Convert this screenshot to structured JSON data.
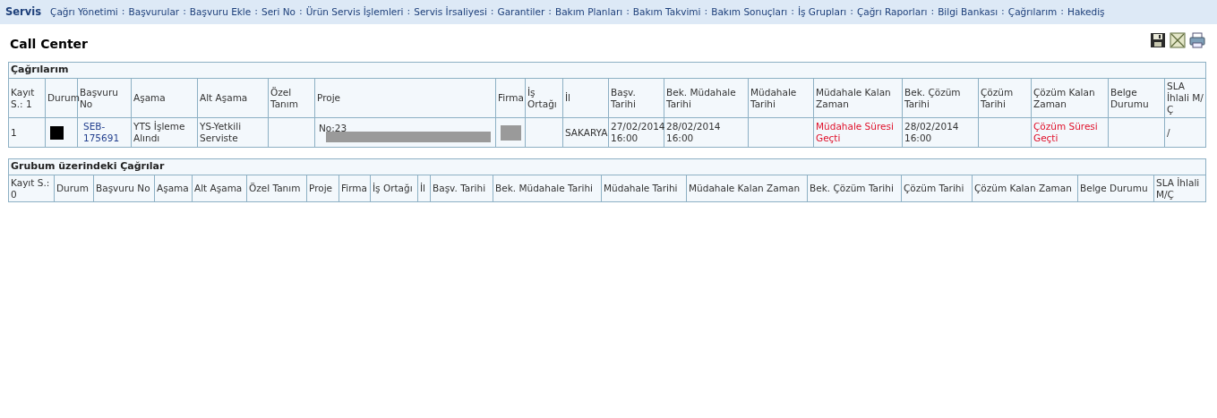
{
  "nav": {
    "brand": "Servis",
    "items": [
      "Çağrı Yönetimi",
      "Başvurular",
      "Başvuru Ekle",
      "Seri No",
      "Ürün Servis İşlemleri",
      "Servis İrsaliyesi",
      "Garantiler",
      "Bakım Planları",
      "Bakım Takvimi",
      "Bakım Sonuçları",
      "İş Grupları",
      "Çağrı Raporları",
      "Bilgi Bankası",
      "Çağrılarım",
      "Hakediş"
    ],
    "separator": ":"
  },
  "page_title": "Call Center",
  "toolbar": [
    {
      "kind": "save"
    },
    {
      "kind": "excel"
    },
    {
      "kind": "print"
    }
  ],
  "tables": [
    {
      "title": "Çağrılarım",
      "columns": [
        "Kayıt S.: 1",
        "Durum",
        "Başvuru No",
        "Aşama",
        "Alt Aşama",
        "Özel Tanım",
        "Proje",
        "Firma",
        "İş Ortağı",
        "İl",
        "Başv. Tarihi",
        "Bek. Müdahale Tarihi",
        "Müdahale Tarihi",
        "Müdahale Kalan Zaman",
        "Bek. Çözüm Tarihi",
        "Çözüm Tarihi",
        "Çözüm Kalan Zaman",
        "Belge Durumu",
        "SLA İhlali M/Ç"
      ],
      "rows": [
        [
          {
            "kind": "text",
            "text": "1"
          },
          {
            "kind": "status",
            "color": "#000000"
          },
          {
            "kind": "link",
            "text": "SEB-175691"
          },
          {
            "kind": "text",
            "text": "YTS İşleme Alındı"
          },
          {
            "kind": "text",
            "text": "YS-Yetkili Serviste"
          },
          {
            "kind": "empty"
          },
          {
            "kind": "redacted",
            "text": "No:23"
          },
          {
            "kind": "redacted"
          },
          {
            "kind": "empty"
          },
          {
            "kind": "text",
            "text": "SAKARYA"
          },
          {
            "kind": "text",
            "text": "27/02/2014 16:00"
          },
          {
            "kind": "text",
            "text": "28/02/2014 16:00"
          },
          {
            "kind": "empty"
          },
          {
            "kind": "alert",
            "text": "Müdahale Süresi Geçti"
          },
          {
            "kind": "text",
            "text": "28/02/2014 16:00"
          },
          {
            "kind": "empty"
          },
          {
            "kind": "alert",
            "text": "Çözüm Süresi Geçti"
          },
          {
            "kind": "empty"
          },
          {
            "kind": "text",
            "text": "/"
          }
        ]
      ]
    },
    {
      "title": "Grubum üzerindeki Çağrılar",
      "columns": [
        "Kayıt S.: 0",
        "Durum",
        "Başvuru No",
        "Aşama",
        "Alt Aşama",
        "Özel Tanım",
        "Proje",
        "Firma",
        "İş Ortağı",
        "İl",
        "Başv. Tarihi",
        "Bek. Müdahale Tarihi",
        "Müdahale Tarihi",
        "Müdahale Kalan Zaman",
        "Bek. Çözüm Tarihi",
        "Çözüm Tarihi",
        "Çözüm Kalan Zaman",
        "Belge Durumu",
        "SLA İhlali M/Ç"
      ]
    }
  ]
}
